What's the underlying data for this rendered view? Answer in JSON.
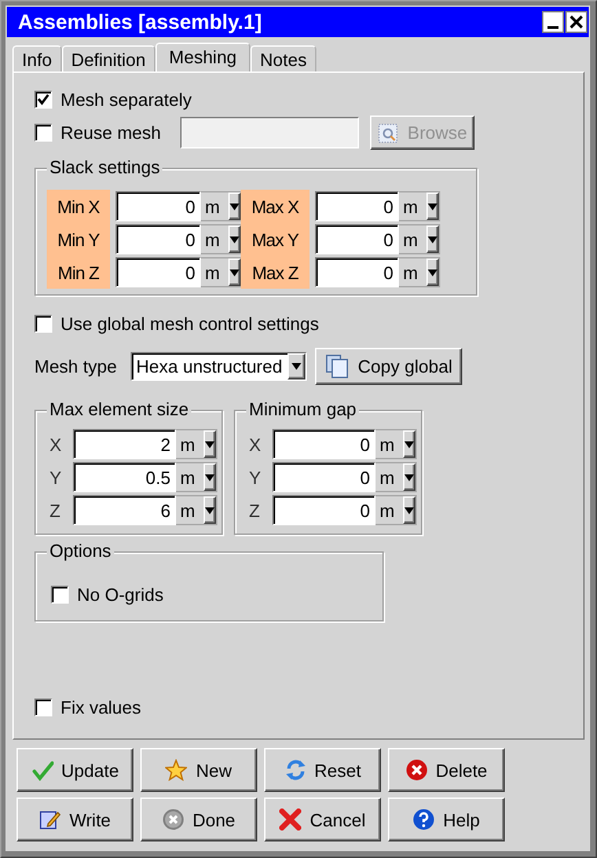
{
  "window": {
    "title": "Assemblies [assembly.1]"
  },
  "tabs": [
    {
      "label": "Info",
      "selected": false
    },
    {
      "label": "Definition",
      "selected": false
    },
    {
      "label": "Meshing",
      "selected": true
    },
    {
      "label": "Notes",
      "selected": false
    }
  ],
  "mesh_separately": {
    "label": "Mesh separately",
    "checked": true
  },
  "reuse_mesh": {
    "label": "Reuse mesh",
    "checked": false,
    "browse_button": {
      "label": "Browse",
      "disabled": true
    }
  },
  "slack_settings": {
    "title": "Slack settings",
    "fields": [
      {
        "label": "Min X",
        "value": "0",
        "unit": "m"
      },
      {
        "label": "Max X",
        "value": "0",
        "unit": "m"
      },
      {
        "label": "Min Y",
        "value": "0",
        "unit": "m"
      },
      {
        "label": "Max Y",
        "value": "0",
        "unit": "m"
      },
      {
        "label": "Min Z",
        "value": "0",
        "unit": "m"
      },
      {
        "label": "Max Z",
        "value": "0",
        "unit": "m"
      }
    ]
  },
  "use_global_mesh_control": {
    "label": "Use global mesh control settings",
    "checked": false
  },
  "mesh_type": {
    "label": "Mesh type",
    "value": "Hexa unstructured",
    "copy_button": "Copy global"
  },
  "max_element_size": {
    "title": "Max element size",
    "fields": [
      {
        "label": "X",
        "value": "2",
        "unit": "m"
      },
      {
        "label": "Y",
        "value": "0.5",
        "unit": "m"
      },
      {
        "label": "Z",
        "value": "6",
        "unit": "m"
      }
    ]
  },
  "minimum_gap": {
    "title": "Minimum gap",
    "fields": [
      {
        "label": "X",
        "value": "0",
        "unit": "m"
      },
      {
        "label": "Y",
        "value": "0",
        "unit": "m"
      },
      {
        "label": "Z",
        "value": "0",
        "unit": "m"
      }
    ]
  },
  "options": {
    "title": "Options",
    "items": [
      {
        "label": "No O-grids",
        "checked": false
      }
    ]
  },
  "fix_values": {
    "label": "Fix values",
    "checked": false
  },
  "buttons": [
    {
      "label": "Update",
      "kind": "update"
    },
    {
      "label": "New",
      "kind": "new"
    },
    {
      "label": "Reset",
      "kind": "reset"
    },
    {
      "label": "Delete",
      "kind": "delete"
    },
    {
      "label": "Write",
      "kind": "write"
    },
    {
      "label": "Done",
      "kind": "done"
    },
    {
      "label": "Cancel",
      "kind": "cancel"
    },
    {
      "label": "Help",
      "kind": "help"
    }
  ]
}
